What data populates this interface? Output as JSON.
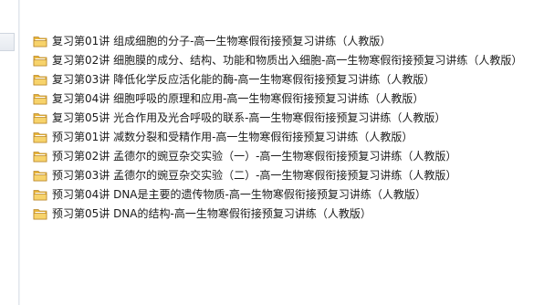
{
  "files": [
    {
      "name": "复习第01讲 组成细胞的分子-高一生物寒假衔接预复习讲练（人教版）",
      "icon": "folder-icon"
    },
    {
      "name": "复习第02讲 细胞膜的成分、结构、功能和物质出入细胞-高一生物寒假衔接预复习讲练（人教版）",
      "icon": "folder-icon"
    },
    {
      "name": "复习第03讲 降低化学反应活化能的酶-高一生物寒假衔接预复习讲练（人教版）",
      "icon": "folder-icon"
    },
    {
      "name": "复习第04讲 细胞呼吸的原理和应用-高一生物寒假衔接预复习讲练（人教版）",
      "icon": "folder-icon"
    },
    {
      "name": "复习第05讲 光合作用及光合呼吸的联系-高一生物寒假衔接预复习讲练（人教版）",
      "icon": "folder-icon"
    },
    {
      "name": "预习第01讲 减数分裂和受精作用-高一生物寒假衔接预复习讲练（人教版）",
      "icon": "folder-icon"
    },
    {
      "name": "预习第02讲 孟德尔的豌豆杂交实验（一）-高一生物寒假衔接预复习讲练（人教版）",
      "icon": "folder-icon"
    },
    {
      "name": "预习第03讲 孟德尔的豌豆杂交实验（二）-高一生物寒假衔接预复习讲练（人教版）",
      "icon": "folder-icon"
    },
    {
      "name": "预习第04讲 DNA是主要的遗传物质-高一生物寒假衔接预复习讲练（人教版）",
      "icon": "folder-icon"
    },
    {
      "name": "预习第05讲 DNA的结构-高一生物寒假衔接预复习讲练（人教版）",
      "icon": "folder-icon"
    }
  ],
  "colors": {
    "folder_body": "#e8b53a",
    "folder_front": "#f7d36b",
    "folder_edge": "#b8862a",
    "text": "#1b1b1b"
  }
}
